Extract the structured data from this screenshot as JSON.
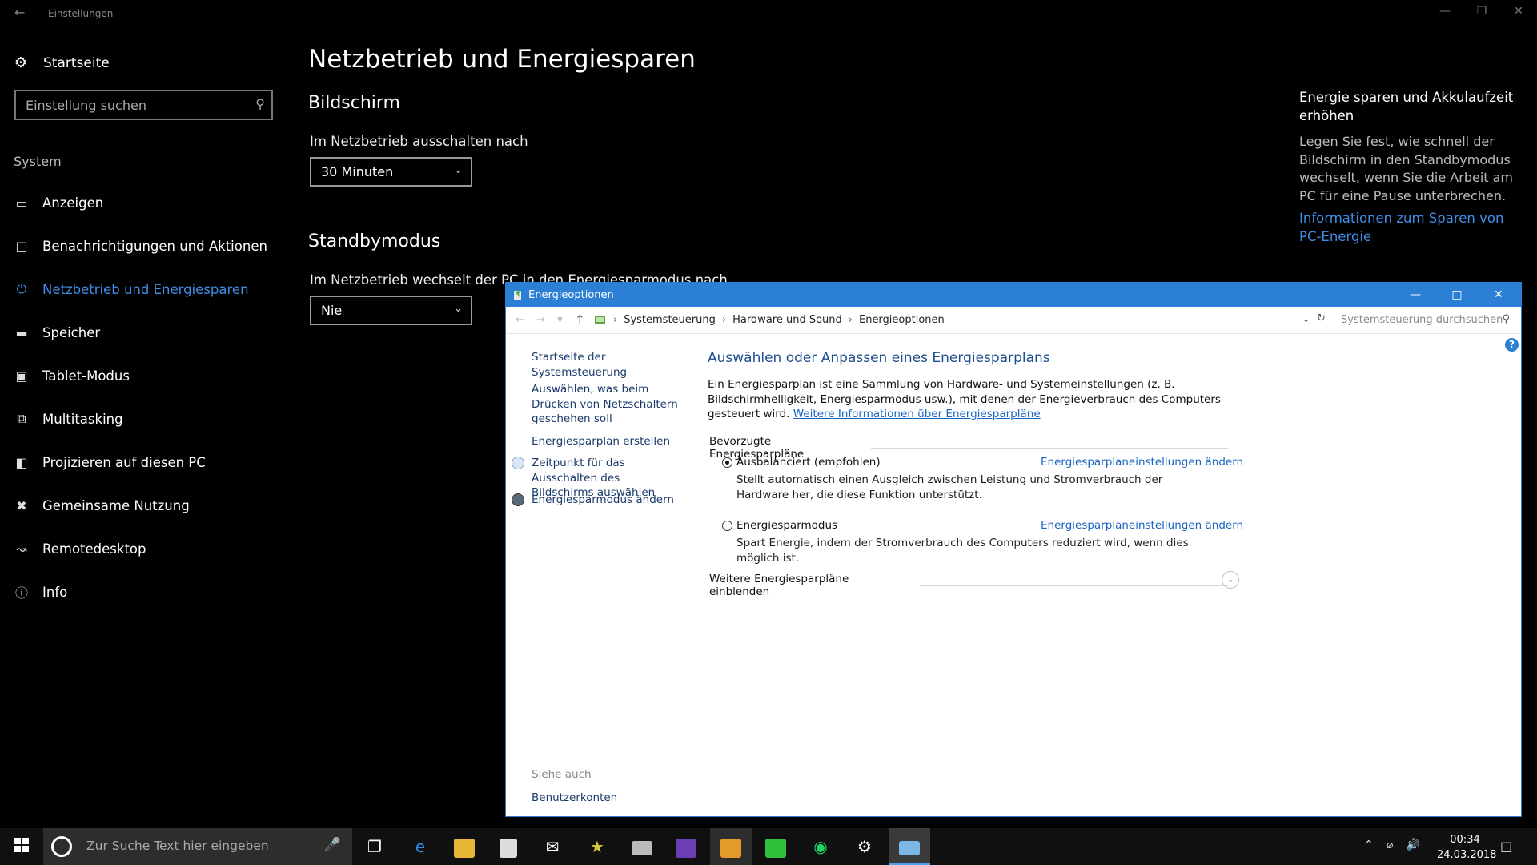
{
  "settings": {
    "window_title": "Einstellungen",
    "home_label": "Startseite",
    "search_placeholder": "Einstellung suchen",
    "section_label": "System",
    "nav": [
      {
        "label": "Anzeigen",
        "icon": "monitor-icon"
      },
      {
        "label": "Benachrichtigungen und Aktionen",
        "icon": "notification-icon"
      },
      {
        "label": "Netzbetrieb und Energiesparen",
        "icon": "power-icon",
        "active": true
      },
      {
        "label": "Speicher",
        "icon": "storage-icon"
      },
      {
        "label": "Tablet-Modus",
        "icon": "tablet-icon"
      },
      {
        "label": "Multitasking",
        "icon": "multitasking-icon"
      },
      {
        "label": "Projizieren auf diesen PC",
        "icon": "project-icon"
      },
      {
        "label": "Gemeinsame Nutzung",
        "icon": "share-icon"
      },
      {
        "label": "Remotedesktop",
        "icon": "remote-icon"
      },
      {
        "label": "Info",
        "icon": "info-icon"
      }
    ],
    "page_title": "Netzbetrieb und Energiesparen",
    "screen_heading": "Bildschirm",
    "screen_label": "Im Netzbetrieb ausschalten nach",
    "screen_value": "30 Minuten",
    "standby_heading": "Standbymodus",
    "standby_label": "Im Netzbetrieb wechselt der PC in den Energiesparmodus nach",
    "standby_value": "Nie",
    "aside_heading": "Energie sparen und Akkulaufzeit erhöhen",
    "aside_text": "Legen Sie fest, wie schnell der Bildschirm in den Standbymodus wechselt, wenn Sie die Arbeit am PC für eine Pause unterbrechen.",
    "aside_link": "Informationen zum Sparen von PC-Energie"
  },
  "dialog": {
    "title": "Energieoptionen",
    "breadcrumb": [
      "Systemsteuerung",
      "Hardware und Sound",
      "Energieoptionen"
    ],
    "search_placeholder": "Systemsteuerung durchsuchen",
    "left_nav": {
      "home": "Startseite der Systemsteuerung",
      "power_button": "Auswählen, was beim Drücken von Netzschaltern geschehen soll",
      "create_plan": "Energiesparplan erstellen",
      "display_off": "Zeitpunkt für das Ausschalten des Bildschirms auswählen",
      "sleep_change": "Energiesparmodus ändern",
      "see_also": "Siehe auch",
      "user_accounts": "Benutzerkonten"
    },
    "heading": "Auswählen oder Anpassen eines Energiesparplans",
    "description": "Ein Energiesparplan ist eine Sammlung von Hardware- und Systemeinstellungen (z. B. Bildschirmhelligkeit, Energiesparmodus usw.), mit denen der Energieverbrauch des Computers gesteuert wird.",
    "description_link": "Weitere Informationen über Energiesparpläne",
    "group_label": "Bevorzugte Energiesparpläne",
    "plans": [
      {
        "name": "Ausbalanciert (empfohlen)",
        "selected": true,
        "edit": "Energiesparplaneinstellungen ändern",
        "desc": "Stellt automatisch einen Ausgleich zwischen Leistung und Stromverbrauch der Hardware her, die diese Funktion unterstützt."
      },
      {
        "name": "Energiesparmodus",
        "selected": false,
        "edit": "Energiesparplaneinstellungen ändern",
        "desc": "Spart Energie, indem der Stromverbrauch des Computers reduziert wird, wenn dies möglich ist."
      }
    ],
    "more_plans": "Weitere Energiesparpläne einblenden"
  },
  "taskbar": {
    "search_placeholder": "Zur Suche Text hier eingeben",
    "time": "00:34",
    "date": "24.03.2018"
  },
  "colors": {
    "accent": "#3f8ee8",
    "dialog_title": "#2b7fd5"
  }
}
